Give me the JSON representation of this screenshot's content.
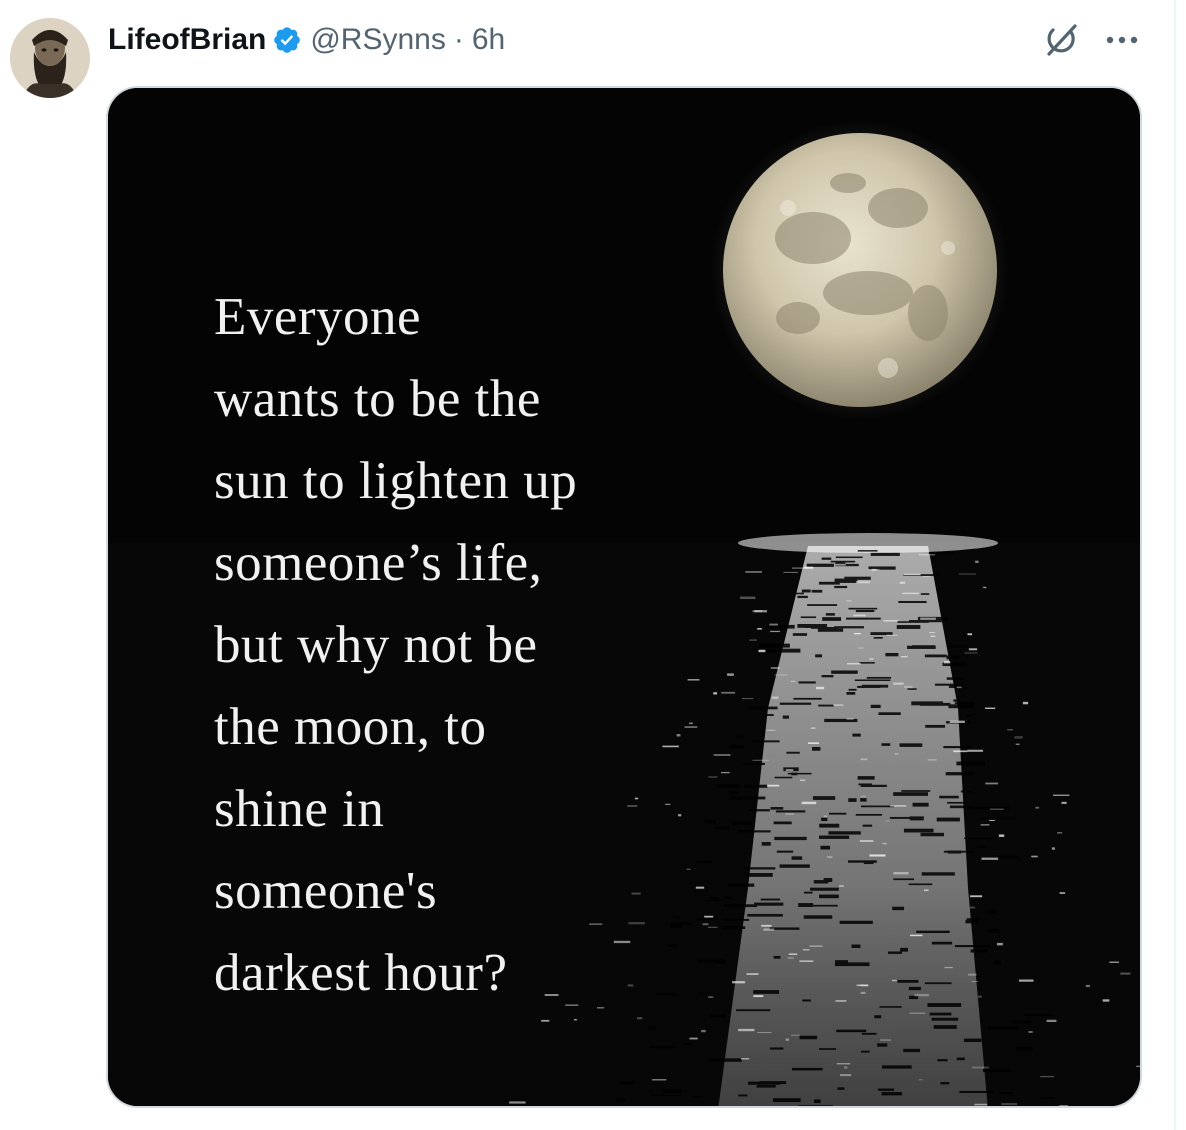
{
  "tweet": {
    "author": {
      "display_name": "LifeofBrian",
      "handle": "@RSynns",
      "verified": true,
      "avatar_icon": "bearded-man-portrait"
    },
    "separator": "·",
    "timestamp": "6h",
    "actions": {
      "grok_icon": "grok-icon",
      "more_icon": "more-options-icon"
    },
    "media": {
      "quote_lines": [
        "Everyone",
        "wants to be the",
        "sun to lighten up",
        "someone’s life,",
        "but why not be",
        "the moon, to",
        "shine in",
        "someone's",
        "darkest hour?"
      ]
    }
  },
  "colors": {
    "text_primary": "#0f1419",
    "text_secondary": "#536471",
    "verified_blue": "#1d9bf0",
    "media_border": "#cfd9de",
    "night_sky": "#040404"
  }
}
